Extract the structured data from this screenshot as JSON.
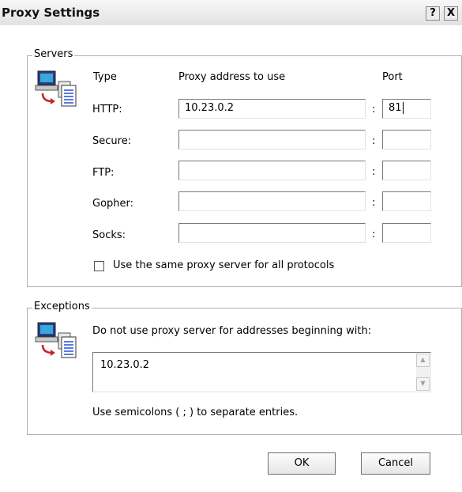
{
  "window": {
    "title": "Proxy Settings",
    "help_glyph": "?",
    "close_glyph": "X"
  },
  "servers": {
    "group_label": "Servers",
    "col_type": "Type",
    "col_address": "Proxy address to use",
    "col_port": "Port",
    "separator": ":",
    "rows": [
      {
        "label": "HTTP:",
        "address": "10.23.0.2",
        "port": "81"
      },
      {
        "label": "Secure:",
        "address": "",
        "port": ""
      },
      {
        "label": "FTP:",
        "address": "",
        "port": ""
      },
      {
        "label": "Gopher:",
        "address": "",
        "port": ""
      },
      {
        "label": "Socks:",
        "address": "",
        "port": ""
      }
    ],
    "same_proxy_label": "Use the same proxy server for all protocols",
    "same_proxy_checked": false
  },
  "exceptions": {
    "group_label": "Exceptions",
    "description": "Do not use proxy server for addresses beginning with:",
    "value": "10.23.0.2",
    "hint": "Use semicolons ( ; ) to separate entries."
  },
  "buttons": {
    "ok": "OK",
    "cancel": "Cancel"
  }
}
